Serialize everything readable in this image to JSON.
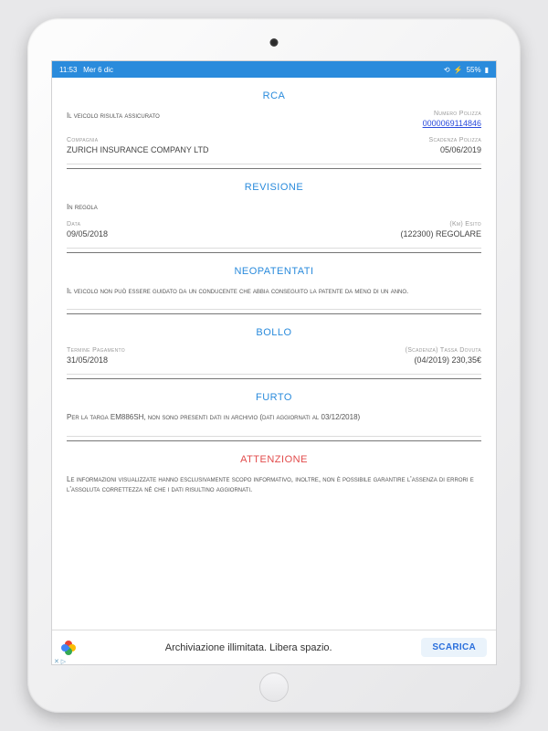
{
  "status": {
    "time": "11:53",
    "date": "Mer 6 dic",
    "battery": "55%"
  },
  "rca": {
    "title": "RCA",
    "status_label": "Il veicolo risulta assicurato",
    "policy_number_label": "Numero Polizza",
    "policy_number": "0000069114846",
    "company_label": "Compagnia",
    "company": "ZURICH INSURANCE COMPANY LTD",
    "expiry_label": "Scadenza Polizza",
    "expiry": "05/06/2019"
  },
  "revisione": {
    "title": "REVISIONE",
    "status": "In regola",
    "date_label": "Data",
    "date": "09/05/2018",
    "km_label": "(Km) Esito",
    "km_result": "(122300) REGOLARE"
  },
  "neopatentati": {
    "title": "NEOPATENTATI",
    "text": "Il veicolo non può essere guidato da un conducente che abbia conseguito la patente da meno di un anno."
  },
  "bollo": {
    "title": "BOLLO",
    "paid_label": "Termine Pagamento",
    "paid": "31/05/2018",
    "due_label": "(Scadenza) Tassa Dovuta",
    "due": "(04/2019) 230,35€"
  },
  "furto": {
    "title": "FURTO",
    "text": "Per la targa EM886SH, non sono presenti dati in archivio (dati aggiornati al 03/12/2018)"
  },
  "attenzione": {
    "title": "ATTENZIONE",
    "text": "Le informazioni visualizzate hanno esclusivamente scopo informativo, inoltre, non è possibile garantire l'assenza di errori e l'assoluta correttezza né che i dati risultino aggiornati."
  },
  "ad": {
    "text": "Archiviazione illimitata. Libera spazio.",
    "cta": "SCARICA"
  }
}
